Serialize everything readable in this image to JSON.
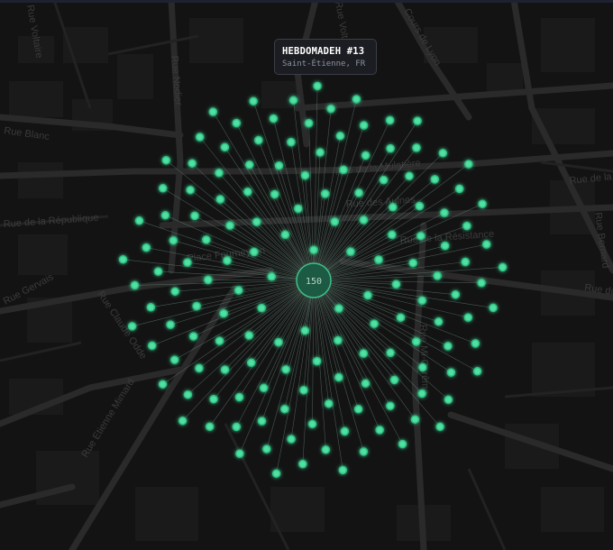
{
  "map": {
    "streets": [
      "Rue Voltaire",
      "Rue Nodier",
      "Cours de Lyon",
      "Rue de la Mulatière",
      "Rue des Aulnes",
      "Rue de la Paix",
      "Place Fourneyron",
      "Rue de la Résistance",
      "Rue Claude Odde",
      "Rue Etienne Mimard",
      "Rue Gervais",
      "Rue du Jeu de l'Arc",
      "Rue Mi-Carême",
      "Rue Bernard",
      "Rue de la République",
      "Rue Blanc"
    ]
  },
  "popup": {
    "title": "HEBDOMADEH #13",
    "subtitle": "Saint-Étienne, FR"
  },
  "cluster": {
    "count": "150",
    "point_count": 150
  },
  "colors": {
    "background": "#131313",
    "marker_fill": "#4fe0a2",
    "marker_glow": "#2fbf83",
    "spider_leg": "#6f8f82",
    "cluster_fill": "#1d5a44",
    "cluster_stroke": "#3fbf8a",
    "cluster_text": "#b9d7c8"
  }
}
